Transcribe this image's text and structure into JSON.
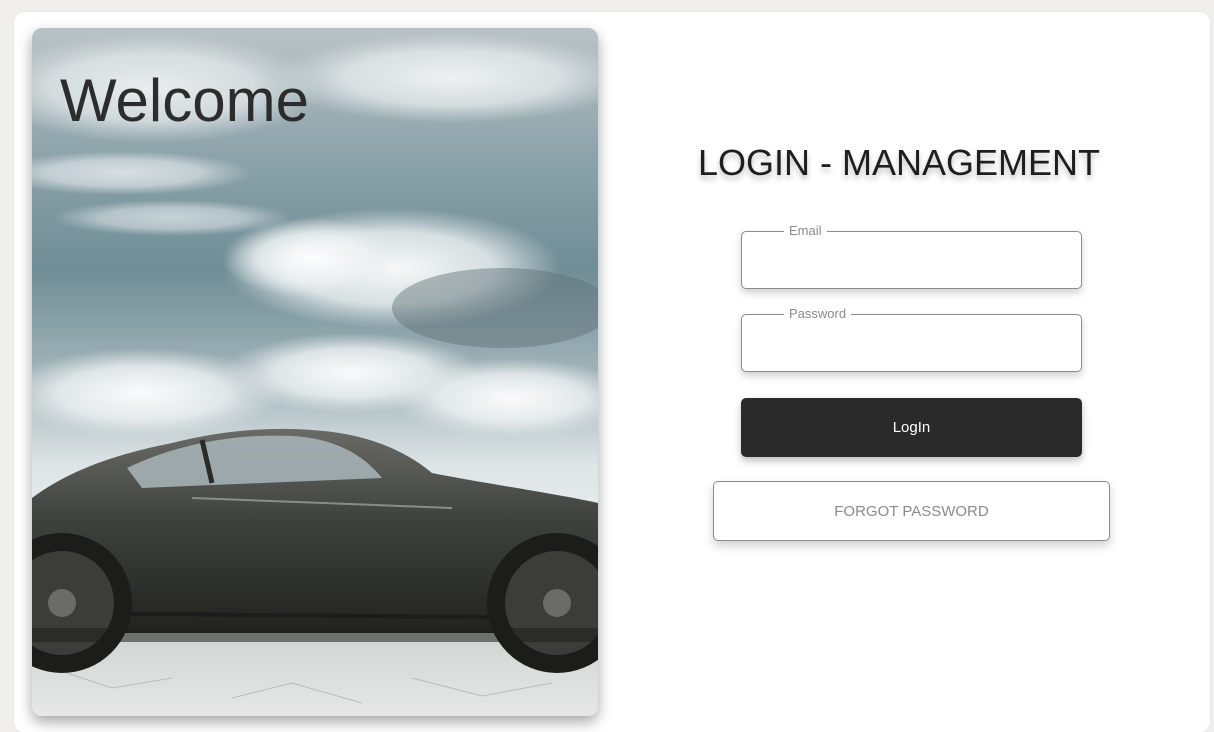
{
  "hero": {
    "welcome_text": "Welcome",
    "image_icon": "sports-car-clouds-photo"
  },
  "form": {
    "title": "LOGIN - MANAGEMENT",
    "email": {
      "label": "Email",
      "value": "",
      "placeholder": ""
    },
    "password": {
      "label": "Password",
      "value": "",
      "placeholder": ""
    },
    "login_label": "LogIn",
    "forgot_label": "FORGOT PASSWORD"
  },
  "colors": {
    "background": "#f1eeee",
    "card": "#ffffff",
    "button_dark": "#2b2a2a",
    "border": "#8c8c8c",
    "muted_text": "#8a8a8a"
  }
}
